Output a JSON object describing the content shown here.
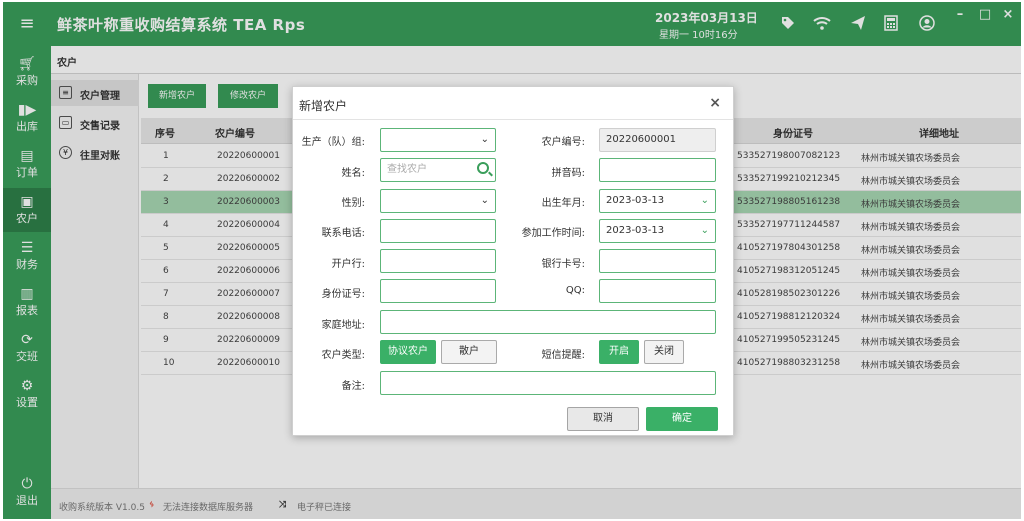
{
  "app": {
    "title": "鲜茶叶称重收购结算系统  TEA  Rps",
    "date": "2023年03月13日",
    "weekday_time": "星期一   10时16分"
  },
  "sidebar": {
    "items": [
      {
        "label": "采购",
        "icon": "cart-icon"
      },
      {
        "label": "出库",
        "icon": "truck-icon"
      },
      {
        "label": "订单",
        "icon": "order-icon"
      },
      {
        "label": "农户",
        "icon": "farmer-icon"
      },
      {
        "label": "财务",
        "icon": "coins-icon"
      },
      {
        "label": "报表",
        "icon": "chart-icon"
      },
      {
        "label": "交班",
        "icon": "refresh-icon"
      },
      {
        "label": "设置",
        "icon": "gear-icon"
      }
    ],
    "exit_label": "退出"
  },
  "page": {
    "title": "农户"
  },
  "submenu": {
    "items": [
      {
        "label": "农户管理"
      },
      {
        "label": "交售记录"
      },
      {
        "label": "往里对账"
      }
    ]
  },
  "toolbar": {
    "add_label": "新增农户",
    "edit_label": "修改农户"
  },
  "table": {
    "headers": {
      "index": "序号",
      "code": "农户编号",
      "id_number": "身份证号",
      "address": "详细地址"
    },
    "rows": [
      {
        "index": "1",
        "code": "20220600001",
        "id_number": "533527198007082123",
        "address": "林州市城关镇农场委员会"
      },
      {
        "index": "2",
        "code": "20220600002",
        "id_number": "533527199210212345",
        "address": "林州市城关镇农场委员会"
      },
      {
        "index": "3",
        "code": "20220600003",
        "id_number": "533527198805161238",
        "address": "林州市城关镇农场委员会"
      },
      {
        "index": "4",
        "code": "20220600004",
        "id_number": "533527197711244587",
        "address": "林州市城关镇农场委员会"
      },
      {
        "index": "5",
        "code": "20220600005",
        "id_number": "410527197804301258",
        "address": "林州市城关镇农场委员会"
      },
      {
        "index": "6",
        "code": "20220600006",
        "id_number": "410527198312051245",
        "address": "林州市城关镇农场委员会"
      },
      {
        "index": "7",
        "code": "20220600007",
        "id_number": "410528198502301226",
        "address": "林州市城关镇农场委员会"
      },
      {
        "index": "8",
        "code": "20220600008",
        "id_number": "410527198812120324",
        "address": "林州市城关镇农场委员会"
      },
      {
        "index": "9",
        "code": "20220600009",
        "id_number": "410527199505231245",
        "address": "林州市城关镇农场委员会"
      },
      {
        "index": "10",
        "code": "20220600010",
        "id_number": "410527198803231258",
        "address": "林州市城关镇农场委员会"
      }
    ]
  },
  "status": {
    "version": "收购系统版本 V1.0.5",
    "db": "无法连接数据库服务器",
    "scale": "电子秤已连接"
  },
  "dialog": {
    "title": "新增农户",
    "fields": {
      "team_label": "生产（队）组:",
      "team_value": "",
      "code_label": "农户编号:",
      "code_value": "20220600001",
      "name_label": "姓名:",
      "name_placeholder": "查找农户",
      "pinyin_label": "拼音码:",
      "pinyin_value": "",
      "gender_label": "性别:",
      "gender_value": "",
      "birth_label": "出生年月:",
      "birth_value": "2023-03-13",
      "phone_label": "联系电话:",
      "phone_value": "",
      "work_label": "参加工作时间:",
      "work_value": "2023-03-13",
      "bank_label": "开户行:",
      "bank_value": "",
      "card_label": "银行卡号:",
      "card_value": "",
      "idno_label": "身份证号:",
      "idno_value": "",
      "qq_label": "QQ:",
      "qq_value": "",
      "address_label": "家庭地址:",
      "address_value": "",
      "type_label": "农户类型:",
      "type_on": "协议农户",
      "type_off": "散户",
      "sms_label": "短信提醒:",
      "sms_on": "开启",
      "sms_off": "关闭",
      "remark_label": "备注:",
      "remark_value": ""
    },
    "cancel_label": "取消",
    "ok_label": "确定"
  }
}
